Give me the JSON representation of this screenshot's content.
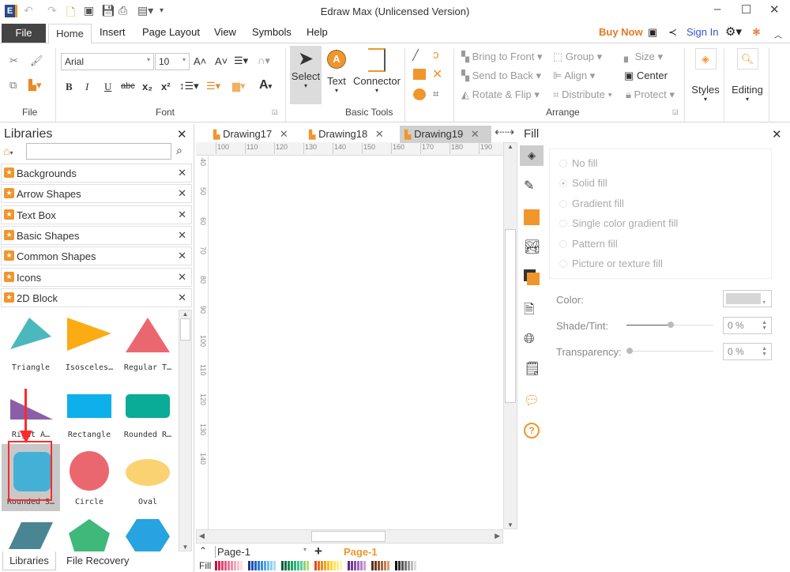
{
  "app": {
    "title": "Edraw Max (Unlicensed Version)"
  },
  "menu": {
    "file": "File",
    "tabs": [
      "Home",
      "Insert",
      "Page Layout",
      "View",
      "Symbols",
      "Help"
    ],
    "buy_now": "Buy Now",
    "sign_in": "Sign In"
  },
  "ribbon": {
    "font_name": "Arial",
    "font_size": "10",
    "groups": {
      "file": "File",
      "font": "Font",
      "basic_tools": "Basic Tools",
      "arrange": "Arrange"
    },
    "select": "Select",
    "text": "Text",
    "connector": "Connector",
    "arrange": {
      "bring_to_front": "Bring to Front",
      "send_to_back": "Send to Back",
      "rotate_flip": "Rotate & Flip",
      "group": "Group",
      "align": "Align",
      "distribute": "Distribute",
      "size": "Size",
      "center": "Center",
      "protect": "Protect"
    },
    "styles": "Styles",
    "editing": "Editing",
    "format": {
      "bold": "B",
      "italic": "I",
      "underline": "U",
      "strike": "abc",
      "subscript": "x₂",
      "superscript": "x²"
    }
  },
  "libraries": {
    "title": "Libraries",
    "search_placeholder": "",
    "categories": [
      "Backgrounds",
      "Arrow Shapes",
      "Text Box",
      "Basic Shapes",
      "Common Shapes",
      "Icons",
      "2D Block"
    ],
    "shapes": [
      {
        "label": "Triangle",
        "color": "#4ab8bd"
      },
      {
        "label": "Isosceles…",
        "color": "#fbab13"
      },
      {
        "label": "Regular T…",
        "color": "#eb6770"
      },
      {
        "label": "Right A…",
        "color": "#8c5ea8"
      },
      {
        "label": "Rectangle",
        "color": "#0eb0ec"
      },
      {
        "label": "Rounded R…",
        "color": "#0aab97"
      },
      {
        "label": "Rounded S…",
        "color": "#45b0d6"
      },
      {
        "label": "Circle",
        "color": "#eb6770"
      },
      {
        "label": "Oval",
        "color": "#fbd272"
      },
      {
        "label": "",
        "color": "#4a8594"
      },
      {
        "label": "",
        "color": "#3fb87a"
      },
      {
        "label": "",
        "color": "#26a3e0"
      }
    ],
    "bottom_tabs": [
      "Libraries",
      "File Recovery"
    ]
  },
  "documents": {
    "tabs": [
      "Drawing17",
      "Drawing18",
      "Drawing19"
    ],
    "active": "Drawing19"
  },
  "rulers": {
    "horizontal": [
      "100",
      "110",
      "120",
      "130",
      "140",
      "150",
      "160",
      "170",
      "180",
      "190"
    ],
    "vertical": [
      "40",
      "50",
      "60",
      "70",
      "80",
      "90",
      "100",
      "110",
      "120",
      "130",
      "140"
    ]
  },
  "pages": {
    "selector": "Page-1",
    "active_tab": "Page-1",
    "fill_label": "Fill"
  },
  "fill_panel": {
    "title": "Fill",
    "options": [
      "No fill",
      "Solid fill",
      "Gradient fill",
      "Single color gradient fill",
      "Pattern fill",
      "Picture or texture fill"
    ],
    "selected": "Solid fill",
    "color_label": "Color:",
    "shade_label": "Shade/Tint:",
    "shade_value": "0 %",
    "transparency_label": "Transparency:",
    "transparency_value": "0 %"
  },
  "colors": {
    "accent": "#f0962c",
    "buy_now": "#e87722",
    "sign_in": "#3355cc",
    "highlight": "#ff2a2a"
  }
}
